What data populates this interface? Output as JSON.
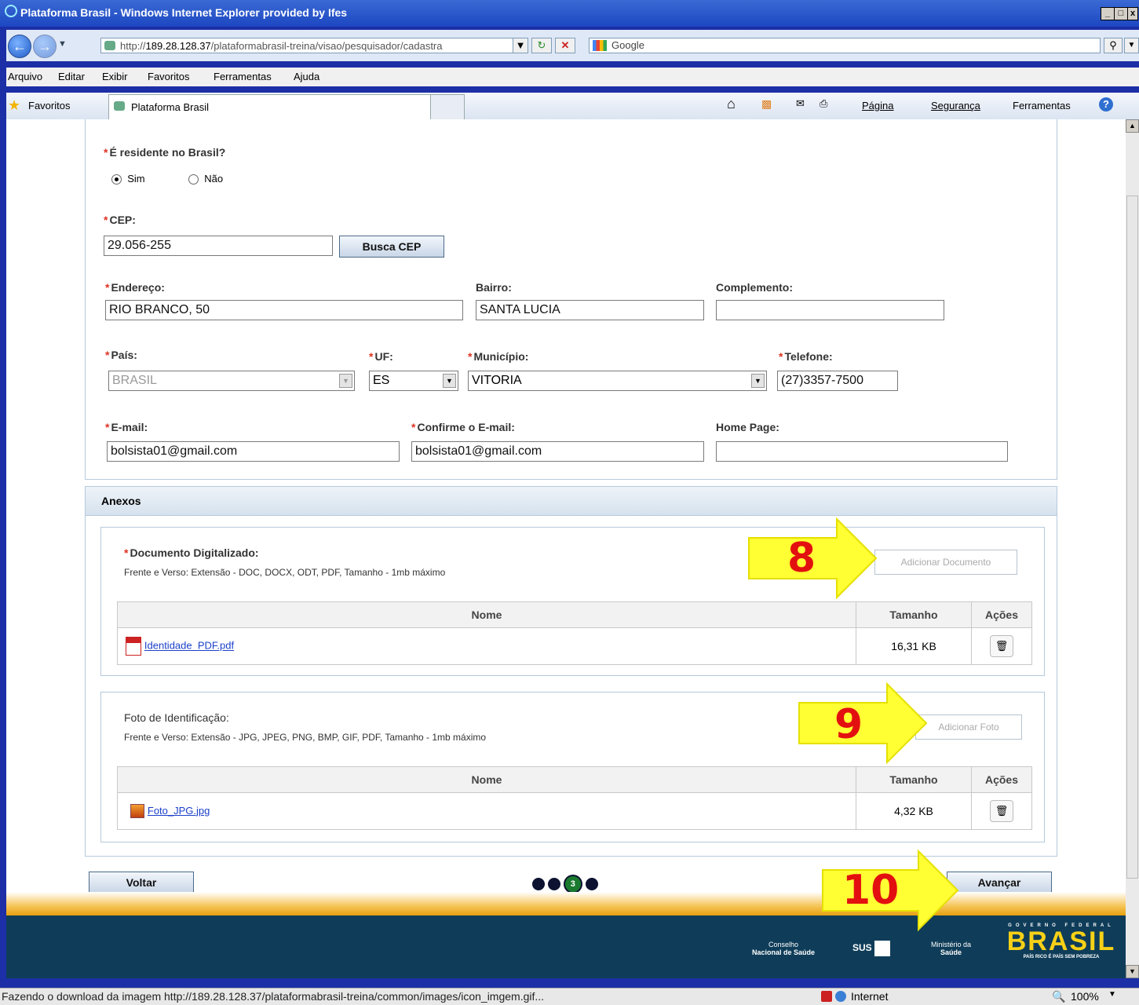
{
  "window": {
    "title": "Plataforma Brasil - Windows Internet Explorer provided by Ifes",
    "controls": [
      "_",
      "□",
      "x"
    ]
  },
  "address": {
    "url_prefix": "http://",
    "url_host": "189.28.128.37",
    "url_path": "/plataformabrasil-treina/visao/pesquisador/cadastra",
    "search_placeholder": "Google"
  },
  "menu": [
    "Arquivo",
    "Editar",
    "Exibir",
    "Favoritos",
    "Ferramentas",
    "Ajuda"
  ],
  "favorites_bar": {
    "favorites_label": "Favoritos",
    "tab_title": "Plataforma Brasil",
    "commands": [
      "Página",
      "Segurança",
      "Ferramentas"
    ]
  },
  "form": {
    "residente_label": "É residente no Brasil?",
    "radio_sim": "Sim",
    "radio_nao": "Não",
    "cep_label": "CEP:",
    "cep_value": "29.056-255",
    "busca_cep": "Busca CEP",
    "endereco_label": "Endereço:",
    "endereco_value": "RIO BRANCO, 50",
    "bairro_label": "Bairro:",
    "bairro_value": "SANTA LUCIA",
    "complemento_label": "Complemento:",
    "complemento_value": "",
    "pais_label": "País:",
    "pais_value": "BRASIL",
    "uf_label": "UF:",
    "uf_value": "ES",
    "municipio_label": "Município:",
    "municipio_value": "VITORIA",
    "telefone_label": "Telefone:",
    "telefone_value": "(27)3357-7500",
    "email_label": "E-mail:",
    "email_value": "bolsista01@gmail.com",
    "confirm_email_label": "Confirme o E-mail:",
    "confirm_email_value": "bolsista01@gmail.com",
    "homepage_label": "Home Page:",
    "homepage_value": ""
  },
  "anexos": {
    "header": "Anexos",
    "doc": {
      "title": "Documento Digitalizado:",
      "hint": "Frente e Verso: Extensão - DOC, DOCX, ODT, PDF, Tamanho - 1mb máximo",
      "add_button": "Adicionar Documento",
      "col_nome": "Nome",
      "col_tamanho": "Tamanho",
      "col_acoes": "Ações",
      "file_name": "Identidade_PDF.pdf",
      "file_size": "16,31 KB"
    },
    "foto": {
      "title": "Foto de Identificação:",
      "hint": "Frente e Verso: Extensão - JPG, JPEG, PNG, BMP, GIF, PDF, Tamanho - 1mb máximo",
      "add_button": "Adicionar Foto",
      "col_nome": "Nome",
      "col_tamanho": "Tamanho",
      "col_acoes": "Ações",
      "file_name": "Foto_JPG.jpg",
      "file_size": "4,32 KB"
    }
  },
  "nav": {
    "back": "Voltar",
    "next": "Avançar",
    "current_step": "3"
  },
  "callouts": [
    "8",
    "9",
    "10"
  ],
  "footer": {
    "logo1_line1": "Conselho",
    "logo1_line2": "Nacional de Saúde",
    "logo2": "SUS",
    "logo3_line1": "Ministério da",
    "logo3_line2": "Saúde",
    "logo4_top": "GOVERNO FEDERAL",
    "logo4_main": "BRASIL",
    "logo4_bottom": "PAÍS RICO É PAÍS SEM POBREZA"
  },
  "status": {
    "text": "Fazendo o download da imagem http://189.28.128.37/plataformabrasil-treina/common/images/icon_imgem.gif...",
    "zone": "Internet",
    "zoom": "100%"
  },
  "colors": {
    "required": "#dd3322",
    "callout_red": "#e31010",
    "arrow_yellow": "#ffff33",
    "footer_bg": "#0f3d59"
  }
}
